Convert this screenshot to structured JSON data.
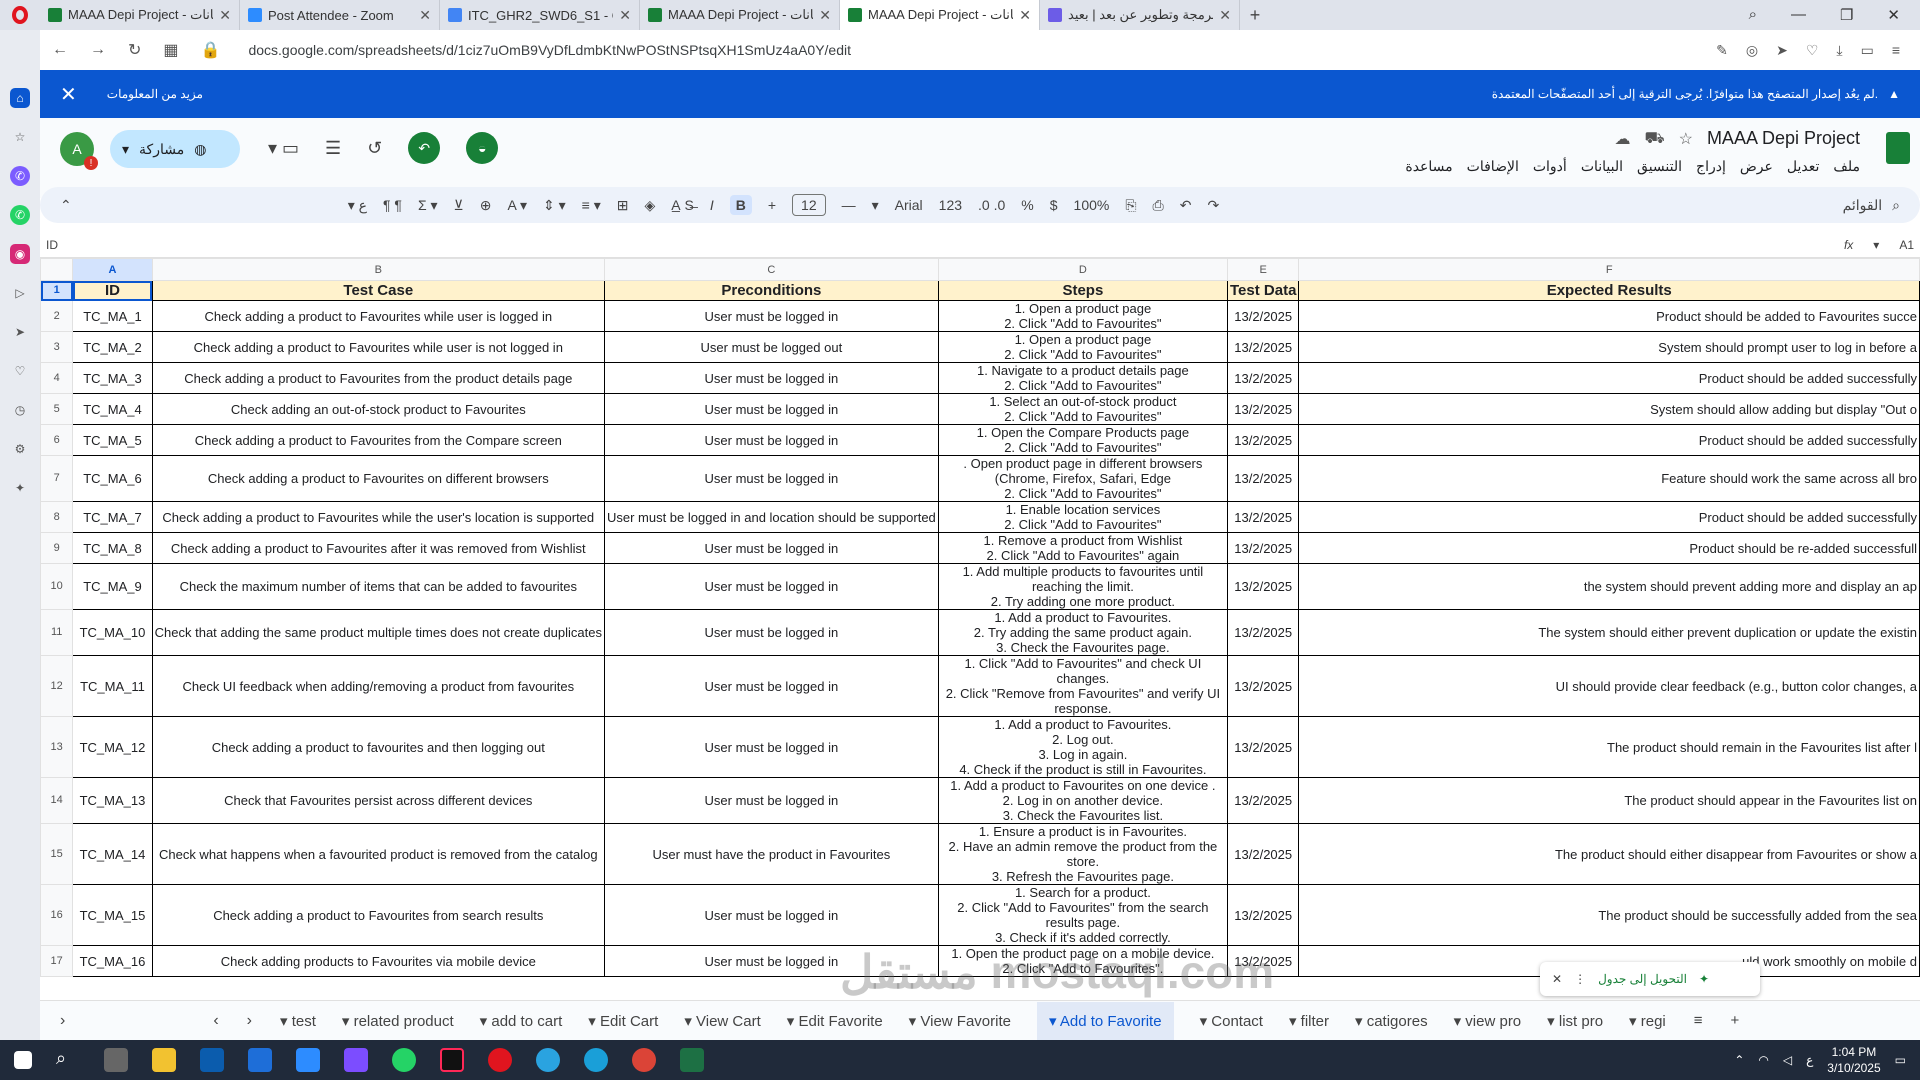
{
  "browser": {
    "tabs": [
      {
        "title": "MAAA Depi Project - بيانات",
        "color": "#188038"
      },
      {
        "title": "Post Attendee - Zoom",
        "color": "#2d8cff"
      },
      {
        "title": "ITC_GHR2_SWD6_S1 - Goo",
        "color": "#4285f4"
      },
      {
        "title": "MAAA Depi Project - بيانات",
        "color": "#188038"
      },
      {
        "title": "MAAA Depi Project - بيانات",
        "color": "#188038",
        "active": true
      },
      {
        "title": "برمجة وتطوير عن بعد | بعيد",
        "color": "#6c5ce7"
      }
    ],
    "url": "docs.google.com/spreadsheets/d/1ciz7uOmB9VyDfLdmbKtNwPOStNSPtsqXH1SmUz4aA0Y/edit"
  },
  "banner": {
    "more_info": "مزيد من المعلومات",
    "message": "لم يعُد إصدار المتصفح هذا متوافرًا. يُرجى الترقية إلى أحد المتصفّحات المعتمدة."
  },
  "header": {
    "doc_title": "MAAA Depi Project",
    "share_label": "مشاركة",
    "account_initial": "A",
    "menus": [
      "ملف",
      "تعديل",
      "عرض",
      "إدراج",
      "التنسيق",
      "البيانات",
      "أدوات",
      "الإضافات",
      "مساعدة"
    ]
  },
  "toolbar": {
    "search": "القوائم",
    "zoom": "100%",
    "currency": "$",
    "percent": "%",
    "format_123": "123",
    "font": "Arial",
    "font_size": "12",
    "bold": "B",
    "italic": "I"
  },
  "formula_bar": {
    "cell_ref": "A1",
    "content": "ID"
  },
  "columns": [
    "A",
    "B",
    "C",
    "D",
    "E",
    "F"
  ],
  "header_row": [
    "ID",
    "Test Case",
    "Preconditions",
    "Steps",
    "Test Data",
    "Expected Results"
  ],
  "rows": [
    {
      "n": "1"
    },
    {
      "n": "2",
      "id": "TC_MA_1",
      "tc": "Check adding a product to Favourites while user is logged in",
      "pre": "User must be logged in",
      "steps": "1. Open a product page\n2. Click \"Add to Favourites\"",
      "date": "13/2/2025",
      "exp": "Product should be added to Favourites succe"
    },
    {
      "n": "3",
      "id": "TC_MA_2",
      "tc": "Check adding a product to Favourites while user is not logged in",
      "pre": "User must be logged out",
      "steps": "1. Open a product page\n2. Click \"Add to Favourites\"",
      "date": "13/2/2025",
      "exp": "System should prompt user to log in before a"
    },
    {
      "n": "4",
      "id": "TC_MA_3",
      "tc": "Check adding a product to Favourites from the product details page",
      "pre": "User must be logged in",
      "steps": "1. Navigate to a product details page\n2. Click \"Add to Favourites\"",
      "date": "13/2/2025",
      "exp": "Product should be added successfully"
    },
    {
      "n": "5",
      "id": "TC_MA_4",
      "tc": "Check adding an out-of-stock product to Favourites",
      "pre": "User must be logged in",
      "steps": "1. Select an out-of-stock product\n2. Click \"Add to Favourites\"",
      "date": "13/2/2025",
      "exp": "System should allow adding but display \"Out o"
    },
    {
      "n": "6",
      "id": "TC_MA_5",
      "tc": "Check adding a product to Favourites from the Compare screen",
      "pre": "User must be logged in",
      "steps": "1. Open the Compare Products page\n2. Click \"Add to Favourites\"",
      "date": "13/2/2025",
      "exp": "Product should be added successfully"
    },
    {
      "n": "7",
      "id": "TC_MA_6",
      "tc": "Check adding a product to Favourites on different browsers",
      "pre": "User must be logged in",
      "steps": ". Open product page in different browsers (Chrome, Firefox, Safari, Edge\n2. Click \"Add to Favourites\"",
      "date": "13/2/2025",
      "exp": "Feature should work the same across all bro"
    },
    {
      "n": "8",
      "id": "TC_MA_7",
      "tc": "Check adding a product to Favourites while the user's location is supported",
      "pre": "User must be logged in and location should be supported",
      "steps": "1. Enable location services\n2. Click \"Add to Favourites\"",
      "date": "13/2/2025",
      "exp": "Product should be added successfully"
    },
    {
      "n": "9",
      "id": "TC_MA_8",
      "tc": "Check adding a product to Favourites after it was removed from Wishlist",
      "pre": "User must be logged in",
      "steps": "1. Remove a product from Wishlist\n2. Click \"Add to Favourites\" again",
      "date": "13/2/2025",
      "exp": "Product should be re-added successfull"
    },
    {
      "n": "10",
      "id": "TC_MA_9",
      "tc": "Check the maximum number of items that can be added to favourites",
      "pre": "User must be logged in",
      "steps": "1. Add multiple products to favourites until reaching the limit.\n2. Try adding one more product.",
      "date": "13/2/2025",
      "exp": "the system should prevent adding more and display an ap"
    },
    {
      "n": "11",
      "id": "TC_MA_10",
      "tc": "Check that adding the same product multiple times does not create duplicates",
      "pre": "User must be logged in",
      "steps": "1. Add a product to Favourites.\n2. Try adding the same product again.\n3. Check the Favourites page.",
      "date": "13/2/2025",
      "exp": "The system should either prevent duplication or update the existin"
    },
    {
      "n": "12",
      "id": "TC_MA_11",
      "tc": "Check UI feedback when adding/removing a product from favourites",
      "pre": "User must be logged in",
      "steps": "1. Click \"Add to Favourites\" and check UI changes.\n2. Click \"Remove from Favourites\" and verify UI response.",
      "date": "13/2/2025",
      "exp": "UI should provide clear feedback (e.g., button color changes, a"
    },
    {
      "n": "13",
      "id": "TC_MA_12",
      "tc": "Check adding a product to favourites and then logging out",
      "pre": "User must be logged in",
      "steps": "1. Add a product to Favourites.\n2. Log out.\n3. Log in again.\n4. Check if the product is still in Favourites.",
      "date": "13/2/2025",
      "exp": "The product should remain in the Favourites list after l"
    },
    {
      "n": "14",
      "id": "TC_MA_13",
      "tc": "Check that Favourites persist across different devices",
      "pre": "User must be logged in",
      "steps": "1. Add a product to Favourites on one device .\n2. Log in on another device.\n3. Check the Favourites list.",
      "date": "13/2/2025",
      "exp": "The product should appear in the Favourites list on"
    },
    {
      "n": "15",
      "id": "TC_MA_14",
      "tc": "Check what happens when a favourited product is removed from the catalog",
      "pre": "User must have the product in Favourites",
      "steps": "1. Ensure a product is in Favourites.\n2. Have an admin remove the product from the store.\n3. Refresh the Favourites page.",
      "date": "13/2/2025",
      "exp": "The product should either disappear from Favourites or show a"
    },
    {
      "n": "16",
      "id": "TC_MA_15",
      "tc": "Check adding a product to Favourites from search results",
      "pre": "User must be logged in",
      "steps": "1. Search for a product.\n2. Click \"Add to Favourites\" from the search results page.\n3. Check if it's added correctly.",
      "date": "13/2/2025",
      "exp": "The product should be successfully added from the sea"
    },
    {
      "n": "17",
      "id": "TC_MA_16",
      "tc": "Check adding products to Favourites via mobile device",
      "pre": "User must be logged in",
      "steps": "1. Open the product page on a mobile device.\n2. Click \"Add to Favourites\".",
      "date": "13/2/2025",
      "exp": "uld work smoothly on mobile d"
    }
  ],
  "convert_chip": "التحويل إلى جدول",
  "sheet_tabs": [
    "test",
    "related product",
    "add to cart",
    "Edit Cart",
    "View Cart",
    "Edit Favorite",
    "View Favorite",
    "Add to Favorite",
    "Contact",
    "filter",
    "catigores",
    "view pro",
    "list pro",
    "regi"
  ],
  "active_sheet": "Add to Favorite",
  "taskbar": {
    "time": "1:04 PM",
    "date": "3/10/2025"
  },
  "watermark": "مستقل mostaql.com"
}
